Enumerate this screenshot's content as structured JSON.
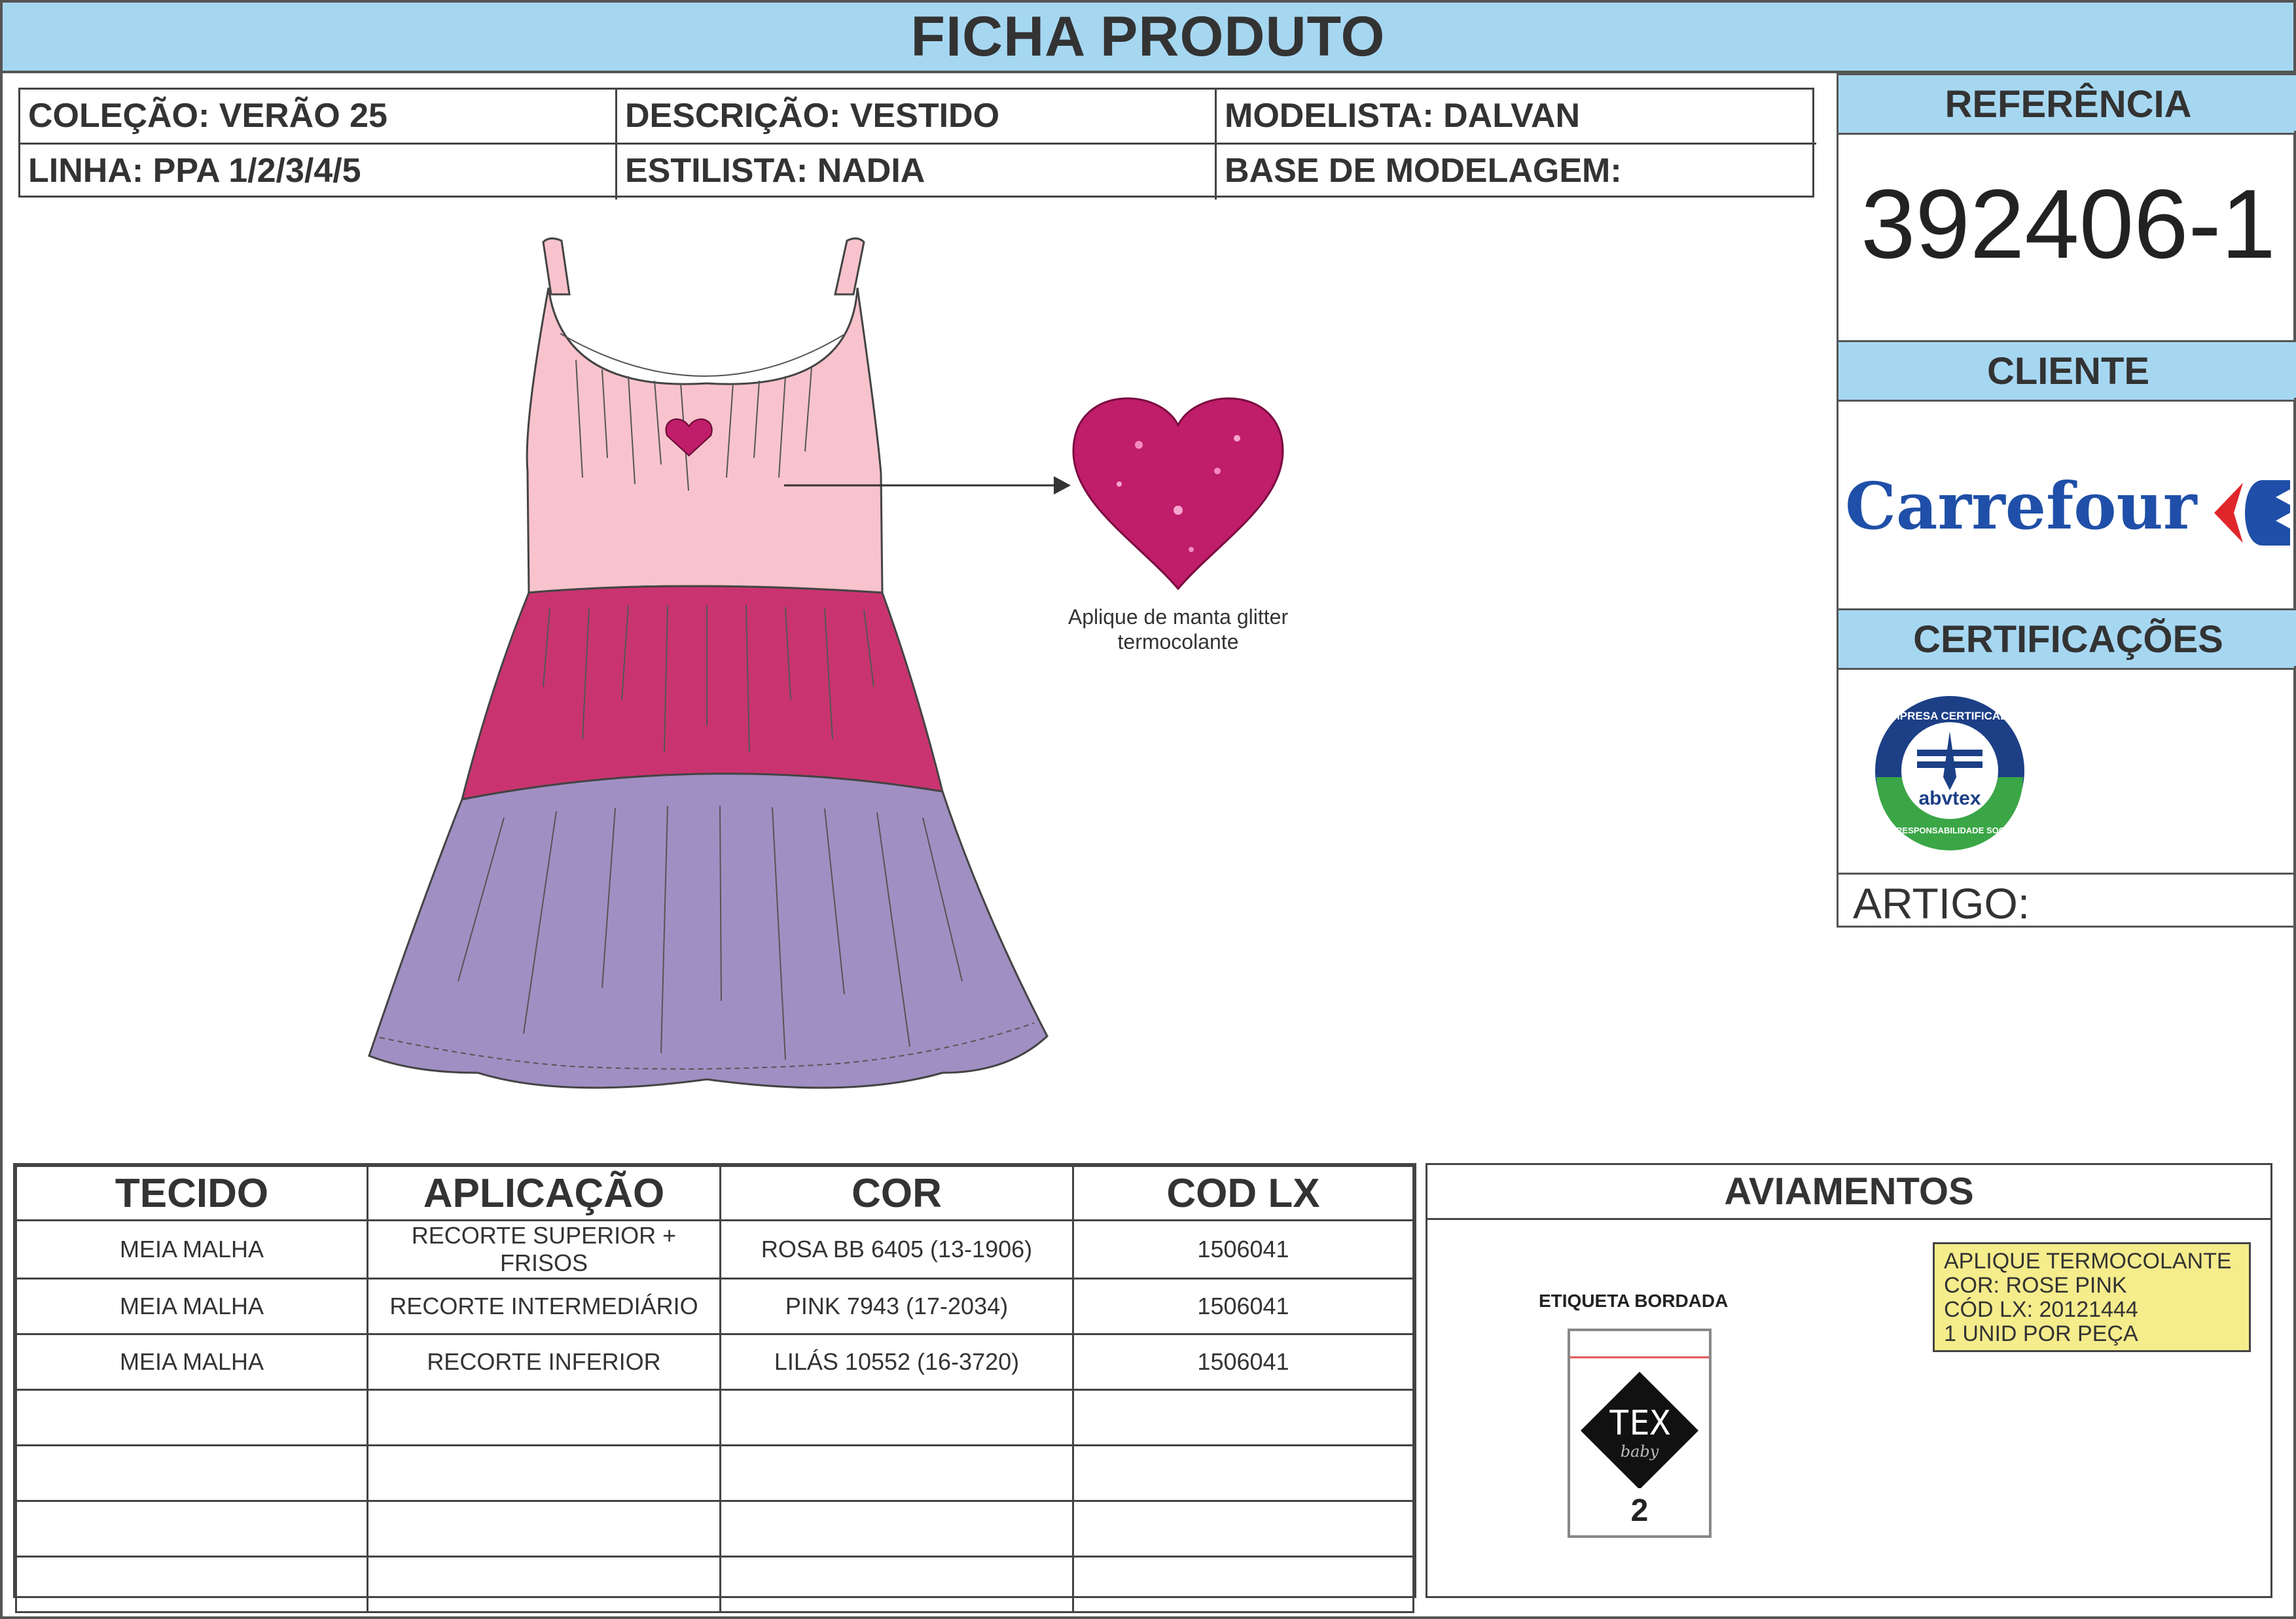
{
  "header": {
    "title": "FICHA PRODUTO"
  },
  "info": {
    "colecao": "COLEÇÃO: VERÃO 25",
    "descricao": "DESCRIÇÃO: VESTIDO",
    "modelista": "MODELISTA: DALVAN",
    "linha": "LINHA: PPA 1/2/3/4/5",
    "estilista": "ESTILISTA: NADIA",
    "base": "BASE DE MODELAGEM:"
  },
  "side": {
    "referencia_label": "REFERÊNCIA",
    "referencia_value": "392406-1",
    "cliente_label": "CLIENTE",
    "cliente_logo_text": "Carrefour",
    "certificacoes_label": "CERTIFICAÇÕES",
    "cert_top_text": "EMPRESA CERTIFICADA",
    "cert_brand": "abvtex",
    "cert_bottom_text": "EM RESPONSABILIDADE SOCIAL",
    "artigo_label": "ARTIGO:"
  },
  "illustration": {
    "applique_caption_line1": "Aplique de manta glitter",
    "applique_caption_line2": "termocolante"
  },
  "colors": {
    "header_blue": "#a6d7f1",
    "dress_top": "#f8c3cc",
    "dress_middle": "#c93470",
    "dress_bottom": "#a08fc3",
    "heart": "#c01d6a",
    "carrefour_blue": "#1f4fa8",
    "carrefour_red": "#e0262b",
    "note_yellow": "#f5ec8c"
  },
  "table": {
    "headers": [
      "TECIDO",
      "APLICAÇÃO",
      "COR",
      "COD LX"
    ],
    "rows": [
      [
        "MEIA MALHA",
        "RECORTE SUPERIOR + FRISOS",
        "ROSA BB 6405 (13-1906)",
        "1506041"
      ],
      [
        "MEIA MALHA",
        "RECORTE INTERMEDIÁRIO",
        "PINK 7943 (17-2034)",
        "1506041"
      ],
      [
        "MEIA MALHA",
        "RECORTE INFERIOR",
        "LILÁS 10552 (16-3720)",
        "1506041"
      ],
      [
        "",
        "",
        "",
        ""
      ],
      [
        "",
        "",
        "",
        ""
      ],
      [
        "",
        "",
        "",
        ""
      ],
      [
        "",
        "",
        "",
        ""
      ]
    ]
  },
  "aviamentos": {
    "title": "AVIAMENTOS",
    "note_lines": [
      "APLIQUE TERMOCOLANTE",
      "COR: ROSE PINK",
      "CÓD LX: 20121444",
      "1 UNID POR PEÇA"
    ],
    "label_caption": "ETIQUETA BORDADA",
    "label_brand": "TEX",
    "label_sub": "baby",
    "label_number": "2"
  }
}
